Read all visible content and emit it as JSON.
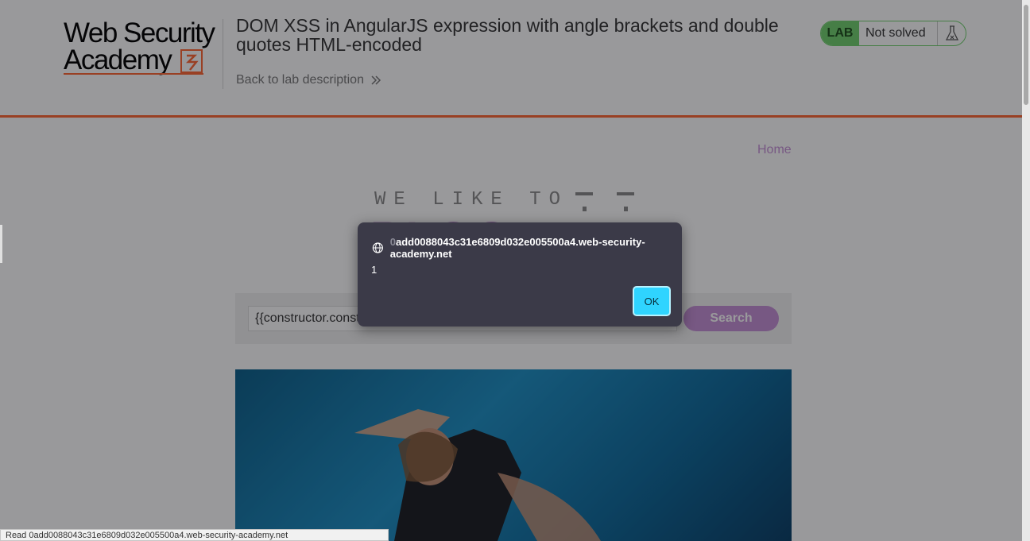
{
  "logo": {
    "line1": "Web Security",
    "line2": "Academy"
  },
  "lab": {
    "title": "DOM XSS in AngularJS expression with angle brackets and double quotes HTML-encoded",
    "back_link": "Back to lab description",
    "badge_label": "LAB",
    "status": "Not solved"
  },
  "nav": {
    "home": "Home"
  },
  "blog": {
    "line1": "WE LIKE TO",
    "line2": "BLOG"
  },
  "search": {
    "value": "{{constructor.const",
    "button": "Search"
  },
  "dialog": {
    "origin_faded": "0",
    "origin": "add0088043c31e6809d032e005500a4.web-security-academy.net",
    "message": "1",
    "ok": "OK"
  },
  "statusbar": {
    "text": "Read 0add0088043c31e6809d032e005500a4.web-security-academy.net"
  },
  "colors": {
    "accent": "#ff6633",
    "blog_purple": "#c58fd6",
    "lab_green": "#70d16d",
    "ok_blue": "#2fd4ff"
  }
}
